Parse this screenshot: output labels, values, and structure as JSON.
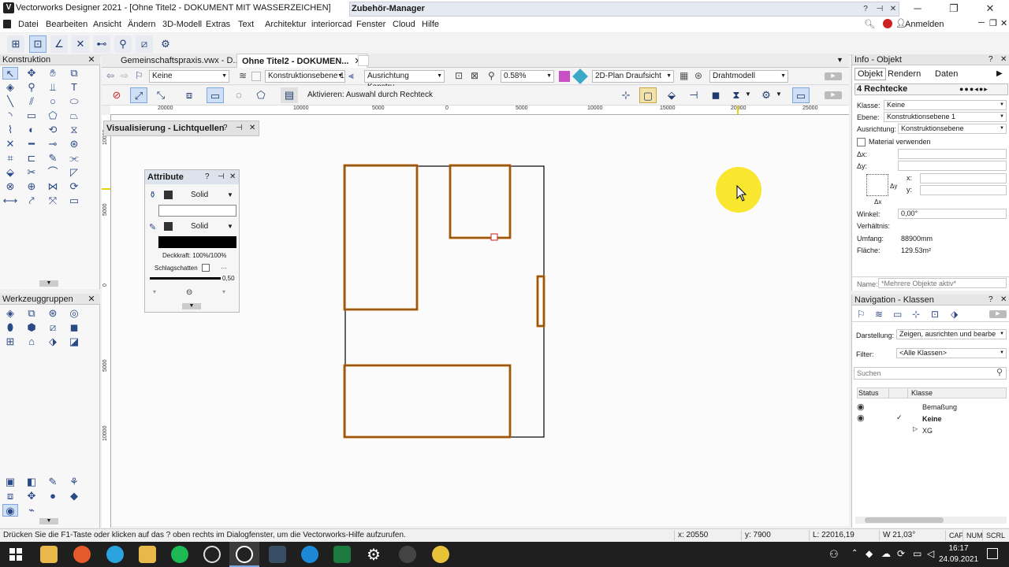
{
  "window": {
    "title": "Vectorworks Designer 2021 - [Ohne Titel2 - DOKUMENT MIT WASSERZEICHEN]"
  },
  "zubehoer": {
    "title": "Zubehör-Manager"
  },
  "menu": {
    "items": [
      "Datei",
      "Bearbeiten",
      "Ansicht",
      "Ändern",
      "3D-Modell",
      "Extras",
      "Text",
      "Architektur",
      "interiorcad",
      "Fenster",
      "Cloud",
      "Hilfe"
    ],
    "signin": "Anmelden"
  },
  "palettes": {
    "konstruktion": {
      "title": "Konstruktion"
    },
    "werkzeuggruppen": {
      "title": "Werkzeuggruppen"
    },
    "visualisierung": {
      "title": "Visualisierung - Lichtquellen"
    }
  },
  "tabs": [
    {
      "label": "Gemeinschaftspraxis.vwx - D..."
    },
    {
      "label": "Ohne Titel2 - DOKUMEN..."
    }
  ],
  "viewbar": {
    "class": "Keine",
    "layer": "Konstruktionsebene 1",
    "alignment": "Ausrichtung Konstru...",
    "zoom": "0.58%",
    "view": "2D-Plan Draufsicht",
    "render": "Drahtmodell"
  },
  "modebar": {
    "hint": "Aktivieren: Auswahl durch Rechteck"
  },
  "ruler": {
    "h": [
      "20000",
      "10000",
      "5000",
      "0",
      "5000",
      "10000",
      "15000",
      "20000",
      "25000"
    ],
    "v": [
      "10000",
      "5000",
      "0",
      "5000",
      "10000"
    ]
  },
  "attribute": {
    "title": "Attribute",
    "fill": "Solid",
    "pen": "Solid",
    "opacity_label": "Deckkraft: 100%/100%",
    "shadow_label": "Schlagschatten",
    "line_weight": "0,50",
    "colors": {
      "fill": "#ffffff",
      "pen": "#000000"
    }
  },
  "info": {
    "title": "Info - Objekt",
    "tabs": [
      "Objekt",
      "Rendern",
      "Daten"
    ],
    "object_title": "4 Rechtecke",
    "klasse_label": "Klasse:",
    "klasse": "Keine",
    "ebene_label": "Ebene:",
    "ebene": "Konstruktionsebene 1",
    "ausrichtung_label": "Ausrichtung:",
    "ausrichtung": "Konstruktionsebene",
    "material_label": "Material verwenden",
    "dx_label": "Δx:",
    "dy_label": "Δy:",
    "x_label": "x:",
    "y_label": "y:",
    "winkel_label": "Winkel:",
    "winkel": "0,00°",
    "verhaeltnis_label": "Verhältnis:",
    "umfang_label": "Umfang:",
    "umfang": "88900mm",
    "flaeche_label": "Fläche:",
    "flaeche": "129.53m²",
    "name_label": "Name:",
    "name_placeholder": "*Mehrere Objekte aktiv*"
  },
  "navigation": {
    "title": "Navigation - Klassen",
    "darstellung_label": "Darstellung:",
    "darstellung": "Zeigen, ausrichten und bearbe",
    "filter_label": "Filter:",
    "filter": "<Alle Klassen>",
    "search_placeholder": "Suchen",
    "col_status": "Status",
    "col_klasse": "Klasse",
    "rows": [
      "Bemaßung",
      "Keine",
      "XG"
    ]
  },
  "status": {
    "hint": "Drücken Sie die F1-Taste oder klicken auf das ? oben rechts im Dialogfenster, um die Vectorworks-Hilfe aufzurufen.",
    "x": "x: 20550",
    "y": "y: 7900",
    "l": "L: 22016,19",
    "w": "W 21,03°",
    "cap": "CAP",
    "num": "NUM",
    "scrl": "SCRL"
  },
  "clock": {
    "time": "16:17",
    "date": "24.09.2021"
  },
  "accent": {
    "selection": "#c8741a",
    "cursor_highlight": "#f7e51c"
  }
}
